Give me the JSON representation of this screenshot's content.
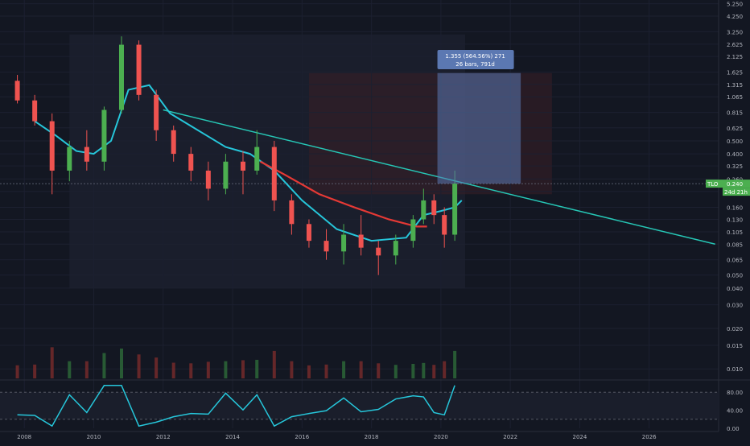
{
  "chart_data": {
    "type": "candlestick",
    "symbol": "TLO",
    "price_axis": {
      "scale": "log",
      "ticks": [
        "5.250",
        "4.250",
        "3.250",
        "2.625",
        "2.125",
        "1.625",
        "1.315",
        "1.065",
        "0.815",
        "0.625",
        "0.500",
        "0.400",
        "0.325",
        "0.260",
        "0.210",
        "0.160",
        "0.130",
        "0.105",
        "0.085",
        "0.065",
        "0.050",
        "0.040",
        "0.030",
        "0.020",
        "0.015",
        "0.010"
      ]
    },
    "time_axis": {
      "ticks": [
        "2008",
        "2010",
        "2012",
        "2014",
        "2016",
        "2018",
        "2020",
        "2022",
        "2024",
        "2026"
      ],
      "range": [
        2007.3,
        2028.0
      ]
    },
    "last_price": {
      "label": "TLO",
      "value": "0.240",
      "countdown": "24d 21h",
      "color": "#4caf50"
    },
    "measure_box": {
      "line1": "1.355 (564.56%) 271",
      "line2": "26 bars, 791d",
      "color": "#5b78b2"
    },
    "trendline": {
      "color": "#26c6b5",
      "from": {
        "x": 2012.0,
        "y": 0.85
      },
      "to": {
        "x": 2027.9,
        "y": 0.085
      }
    },
    "candles_approx": [
      {
        "x": 2007.8,
        "o": 1.4,
        "h": 1.55,
        "l": 0.95,
        "c": 1.0
      },
      {
        "x": 2008.3,
        "o": 1.0,
        "h": 1.1,
        "l": 0.65,
        "c": 0.7
      },
      {
        "x": 2008.8,
        "o": 0.7,
        "h": 0.8,
        "l": 0.2,
        "c": 0.3
      },
      {
        "x": 2009.3,
        "o": 0.3,
        "h": 0.5,
        "l": 0.25,
        "c": 0.45
      },
      {
        "x": 2009.8,
        "o": 0.45,
        "h": 0.6,
        "l": 0.3,
        "c": 0.35
      },
      {
        "x": 2010.3,
        "o": 0.35,
        "h": 0.9,
        "l": 0.3,
        "c": 0.85
      },
      {
        "x": 2010.8,
        "o": 0.85,
        "h": 3.0,
        "l": 0.8,
        "c": 2.6
      },
      {
        "x": 2011.3,
        "o": 2.6,
        "h": 2.8,
        "l": 1.0,
        "c": 1.1
      },
      {
        "x": 2011.8,
        "o": 1.1,
        "h": 1.2,
        "l": 0.5,
        "c": 0.6
      },
      {
        "x": 2012.3,
        "o": 0.6,
        "h": 0.65,
        "l": 0.35,
        "c": 0.4
      },
      {
        "x": 2012.8,
        "o": 0.4,
        "h": 0.45,
        "l": 0.25,
        "c": 0.3
      },
      {
        "x": 2013.3,
        "o": 0.3,
        "h": 0.35,
        "l": 0.18,
        "c": 0.22
      },
      {
        "x": 2013.8,
        "o": 0.22,
        "h": 0.4,
        "l": 0.2,
        "c": 0.35
      },
      {
        "x": 2014.3,
        "o": 0.35,
        "h": 0.42,
        "l": 0.2,
        "c": 0.3
      },
      {
        "x": 2014.7,
        "o": 0.3,
        "h": 0.6,
        "l": 0.28,
        "c": 0.45
      },
      {
        "x": 2015.2,
        "o": 0.45,
        "h": 0.5,
        "l": 0.15,
        "c": 0.18
      },
      {
        "x": 2015.7,
        "o": 0.18,
        "h": 0.2,
        "l": 0.1,
        "c": 0.12
      },
      {
        "x": 2016.2,
        "o": 0.12,
        "h": 0.13,
        "l": 0.08,
        "c": 0.09
      },
      {
        "x": 2016.7,
        "o": 0.09,
        "h": 0.11,
        "l": 0.065,
        "c": 0.075
      },
      {
        "x": 2017.2,
        "o": 0.075,
        "h": 0.12,
        "l": 0.06,
        "c": 0.1
      },
      {
        "x": 2017.7,
        "o": 0.1,
        "h": 0.14,
        "l": 0.07,
        "c": 0.08
      },
      {
        "x": 2018.2,
        "o": 0.08,
        "h": 0.09,
        "l": 0.05,
        "c": 0.07
      },
      {
        "x": 2018.7,
        "o": 0.07,
        "h": 0.1,
        "l": 0.06,
        "c": 0.09
      },
      {
        "x": 2019.2,
        "o": 0.09,
        "h": 0.14,
        "l": 0.08,
        "c": 0.13
      },
      {
        "x": 2019.5,
        "o": 0.13,
        "h": 0.22,
        "l": 0.12,
        "c": 0.18
      },
      {
        "x": 2019.8,
        "o": 0.18,
        "h": 0.2,
        "l": 0.12,
        "c": 0.14
      },
      {
        "x": 2020.1,
        "o": 0.14,
        "h": 0.16,
        "l": 0.08,
        "c": 0.1
      },
      {
        "x": 2020.4,
        "o": 0.1,
        "h": 0.3,
        "l": 0.09,
        "c": 0.24
      }
    ],
    "sma_red_approx": [
      {
        "x": 2014.8,
        "y": 0.35
      },
      {
        "x": 2015.5,
        "y": 0.28
      },
      {
        "x": 2016.5,
        "y": 0.2
      },
      {
        "x": 2017.5,
        "y": 0.16
      },
      {
        "x": 2018.5,
        "y": 0.13
      },
      {
        "x": 2019.3,
        "y": 0.115
      },
      {
        "x": 2019.6,
        "y": 0.115
      }
    ],
    "ema_cyan_approx": [
      {
        "x": 2008.3,
        "y": 0.7
      },
      {
        "x": 2008.9,
        "y": 0.55
      },
      {
        "x": 2009.5,
        "y": 0.42
      },
      {
        "x": 2010.0,
        "y": 0.4
      },
      {
        "x": 2010.5,
        "y": 0.5
      },
      {
        "x": 2011.0,
        "y": 1.2
      },
      {
        "x": 2011.6,
        "y": 1.3
      },
      {
        "x": 2012.2,
        "y": 0.8
      },
      {
        "x": 2013.0,
        "y": 0.6
      },
      {
        "x": 2013.8,
        "y": 0.45
      },
      {
        "x": 2014.5,
        "y": 0.4
      },
      {
        "x": 2015.2,
        "y": 0.3
      },
      {
        "x": 2016.0,
        "y": 0.18
      },
      {
        "x": 2017.0,
        "y": 0.11
      },
      {
        "x": 2018.0,
        "y": 0.09
      },
      {
        "x": 2019.0,
        "y": 0.095
      },
      {
        "x": 2019.5,
        "y": 0.14
      },
      {
        "x": 2020.0,
        "y": 0.15
      },
      {
        "x": 2020.4,
        "y": 0.16
      },
      {
        "x": 2020.6,
        "y": 0.18
      }
    ],
    "oscillator": {
      "ticks": [
        "80.00",
        "40.00",
        "0.00"
      ],
      "levels": [
        80,
        20
      ],
      "range": [
        0,
        100
      ]
    }
  }
}
